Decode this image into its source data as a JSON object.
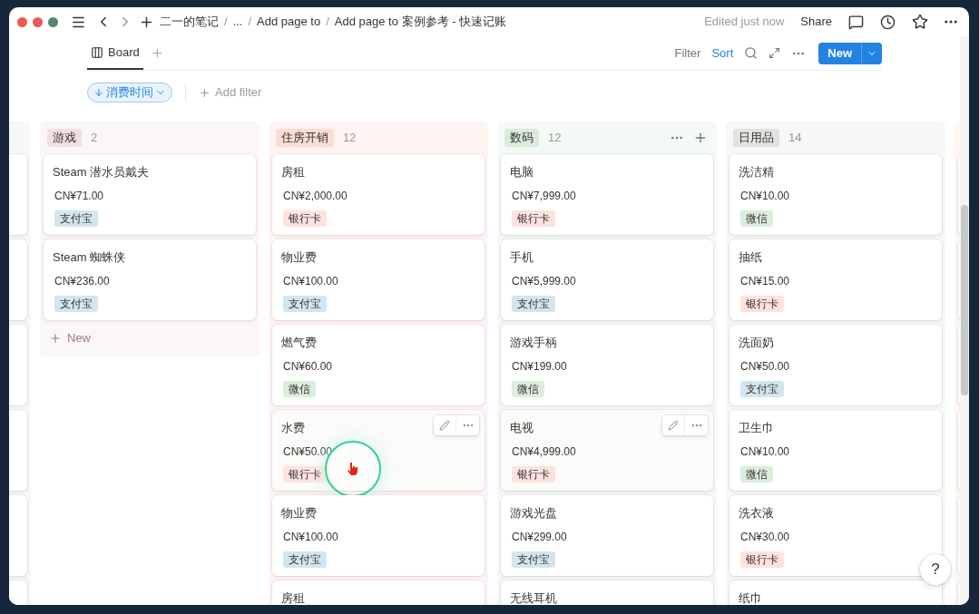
{
  "titlebar": {
    "breadcrumbs": [
      "二一的笔记",
      "...",
      "Add page to",
      "Add page to 案例参考 - 快速记账"
    ],
    "separator": "/",
    "status": "Edited just now",
    "share": "Share"
  },
  "views": {
    "tabs": [
      {
        "label": "Board",
        "selected": true
      }
    ],
    "filter": "Filter",
    "sort": {
      "label": "Sort",
      "active": true
    },
    "new_button": "New"
  },
  "sort_pill": {
    "label": "消费时间"
  },
  "add_filter": "Add filter",
  "columns": [
    {
      "name": "游戏",
      "count": "2",
      "color": "#f0e0e2",
      "hovered": false,
      "footer": "New",
      "cards": [
        {
          "title": "Steam 潜水员戴夫",
          "amount": "CN¥71.00",
          "tag": {
            "label": "支付宝",
            "color": "#d3e5ef"
          },
          "hovered": false
        },
        {
          "title": "Steam 蜘蛛侠",
          "amount": "CN¥236.00",
          "tag": {
            "label": "支付宝",
            "color": "#d3e5ef"
          },
          "hovered": false
        }
      ]
    },
    {
      "name": "住房开销",
      "count": "12",
      "color": "#fcdcd5",
      "hovered": false,
      "cards": [
        {
          "title": "房租",
          "amount": "CN¥2,000.00",
          "tag": {
            "label": "银行卡",
            "color": "#ffe2dd"
          },
          "hovered": false
        },
        {
          "title": "物业费",
          "amount": "CN¥100.00",
          "tag": {
            "label": "支付宝",
            "color": "#d3e5ef"
          },
          "hovered": false
        },
        {
          "title": "燃气费",
          "amount": "CN¥60.00",
          "tag": {
            "label": "微信",
            "color": "#dbeddb"
          },
          "hovered": false
        },
        {
          "title": "水费",
          "amount": "CN¥50.00",
          "tag": {
            "label": "银行卡",
            "color": "#ffe2dd"
          },
          "hovered": true,
          "clicked": true
        },
        {
          "title": "物业费",
          "amount": "CN¥100.00",
          "tag": {
            "label": "支付宝",
            "color": "#d3e5ef"
          },
          "hovered": false
        },
        {
          "title": "房租",
          "hovered": false
        }
      ]
    },
    {
      "name": "数码",
      "count": "12",
      "color": "#dbebdc",
      "hovered": true,
      "cards": [
        {
          "title": "电脑",
          "amount": "CN¥7,999.00",
          "tag": {
            "label": "银行卡",
            "color": "#ffe2dd"
          },
          "hovered": false
        },
        {
          "title": "手机",
          "amount": "CN¥5,999.00",
          "tag": {
            "label": "支付宝",
            "color": "#d3e5ef"
          },
          "hovered": false
        },
        {
          "title": "游戏手柄",
          "amount": "CN¥199.00",
          "tag": {
            "label": "微信",
            "color": "#dbeddb"
          },
          "hovered": false
        },
        {
          "title": "电视",
          "amount": "CN¥4,999.00",
          "tag": {
            "label": "银行卡",
            "color": "#ffe2dd"
          },
          "hovered": true
        },
        {
          "title": "游戏光盘",
          "amount": "CN¥299.00",
          "tag": {
            "label": "支付宝",
            "color": "#d3e5ef"
          },
          "hovered": false
        },
        {
          "title": "无线耳机",
          "hovered": false
        }
      ]
    },
    {
      "name": "日用品",
      "count": "14",
      "color": "#e3e2e0",
      "hovered": false,
      "cards": [
        {
          "title": "洗洁精",
          "amount": "CN¥10.00",
          "tag": {
            "label": "微信",
            "color": "#dbeddb"
          },
          "hovered": false
        },
        {
          "title": "抽纸",
          "amount": "CN¥15.00",
          "tag": {
            "label": "银行卡",
            "color": "#ffe2dd"
          },
          "hovered": false
        },
        {
          "title": "洗面奶",
          "amount": "CN¥50.00",
          "tag": {
            "label": "支付宝",
            "color": "#d3e5ef"
          },
          "hovered": false
        },
        {
          "title": "卫生巾",
          "amount": "CN¥10.00",
          "tag": {
            "label": "微信",
            "color": "#dbeddb"
          },
          "hovered": false
        },
        {
          "title": "洗衣液",
          "amount": "CN¥30.00",
          "tag": {
            "label": "银行卡",
            "color": "#ffe2dd"
          },
          "hovered": false
        },
        {
          "title": "纸巾",
          "hovered": false
        }
      ]
    }
  ],
  "help": "?"
}
